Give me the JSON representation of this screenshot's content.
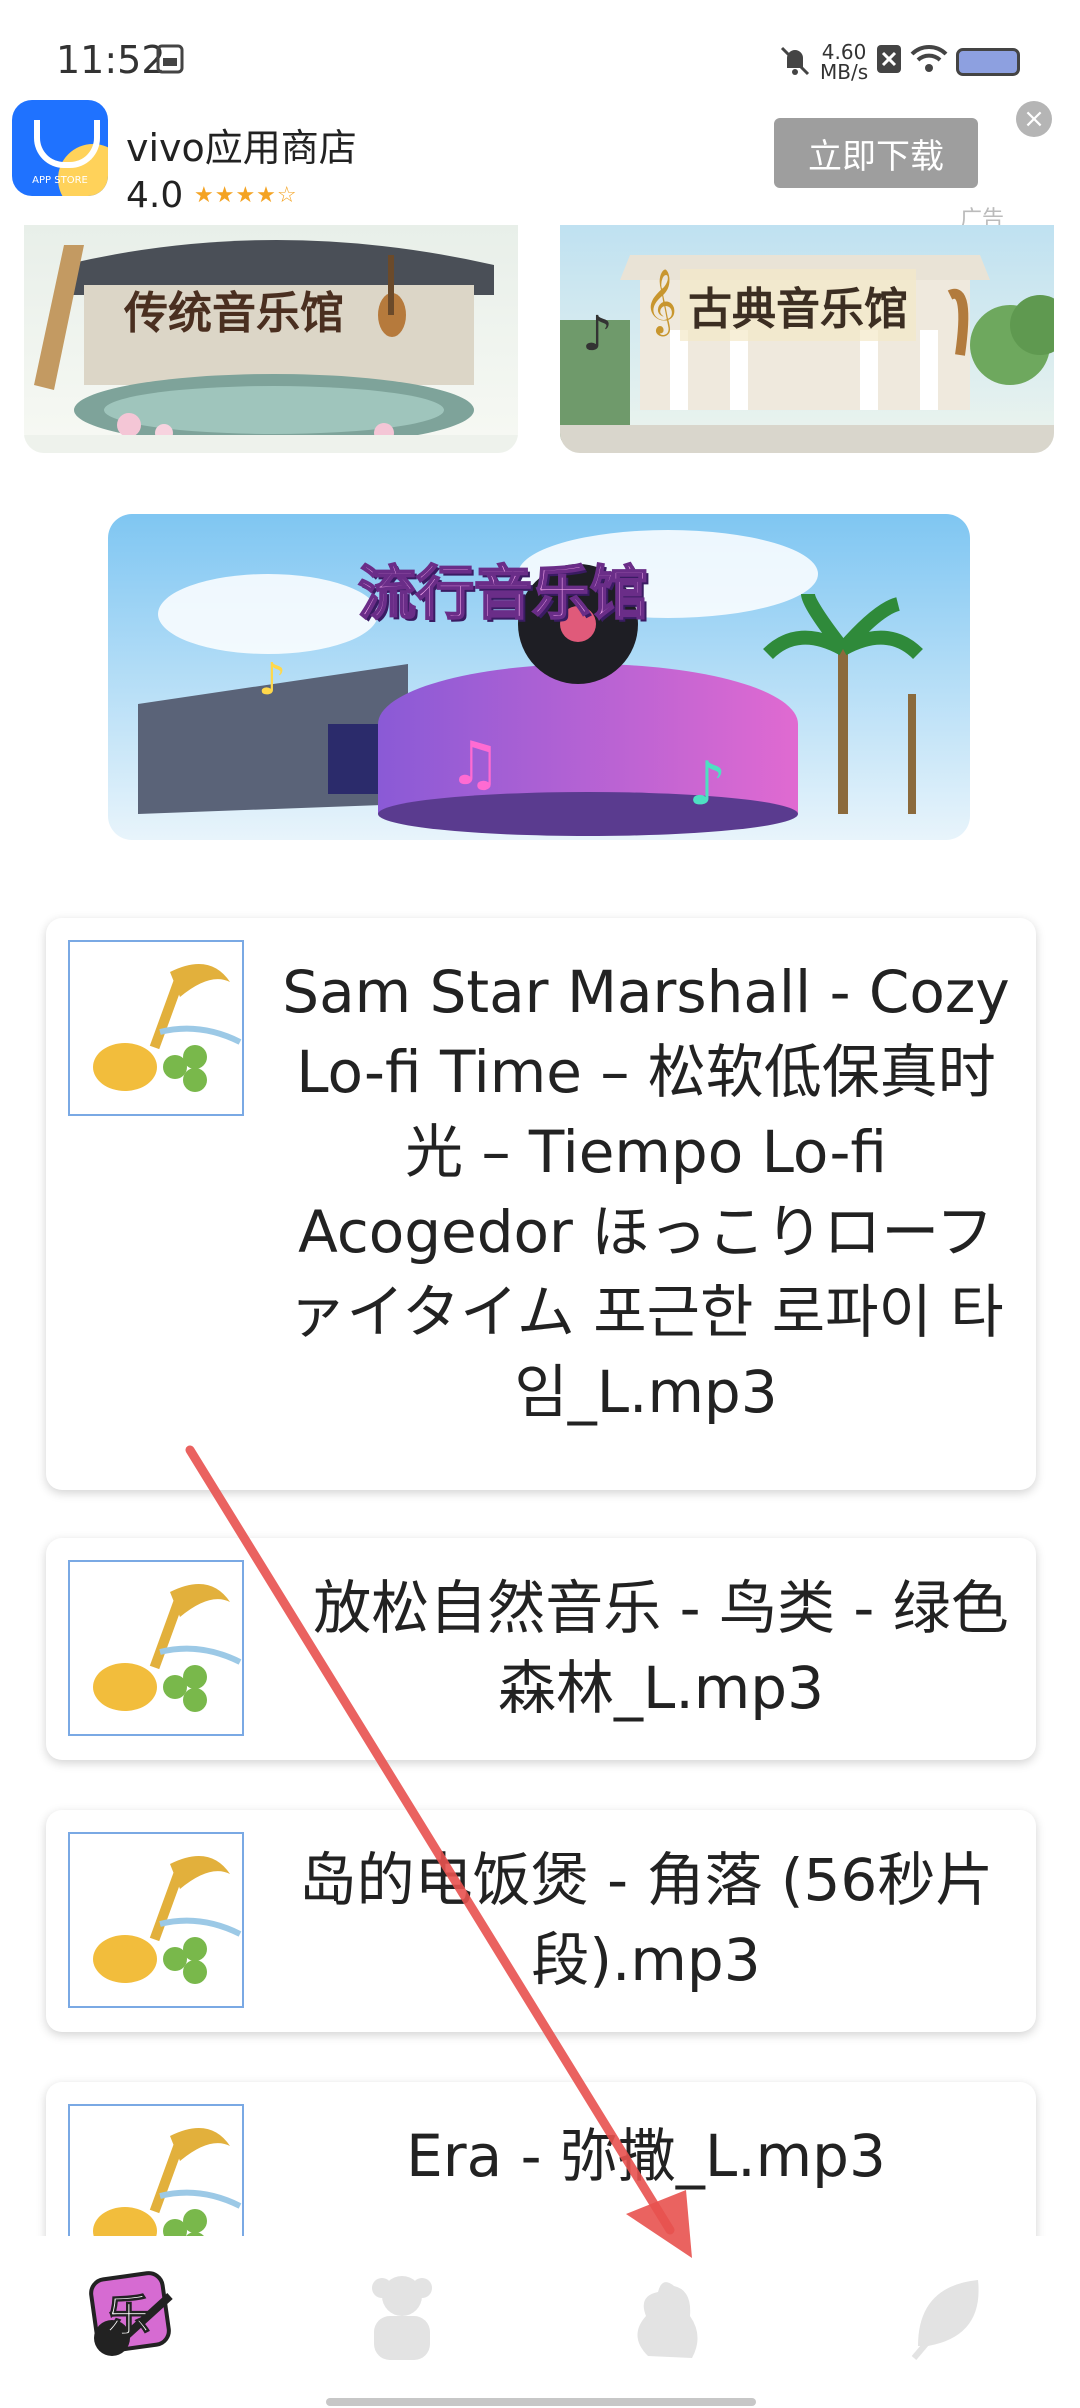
{
  "status_bar": {
    "time": "11:52",
    "net_speed_value": "4.60",
    "net_speed_unit": "MB/s"
  },
  "ad": {
    "app_name": "vivo应用商店",
    "rating": "4.0",
    "stars": "★★★★☆",
    "download_label": "立即下载",
    "close_label": "×",
    "ad_label": "广告",
    "logo_text": "APP STORE"
  },
  "halls": {
    "traditional": "传统音乐馆",
    "classical": "古典音乐馆",
    "pop": "流行音乐馆"
  },
  "songs": [
    {
      "title": "Sam Star Marshall - Cozy Lo-fi Time – 松软低保真时光 – Tiempo Lo-fi Acogedor ほっこりローファイタイム 포근한 로파이 타임_L.mp3"
    },
    {
      "title": "放松自然音乐 - 鸟类 - 绿色森林_L.mp3"
    },
    {
      "title": "岛的电饭煲 - 角落 (56秒片段).mp3"
    },
    {
      "title": "Era - 弥撒_L.mp3"
    }
  ],
  "bottom_nav": {
    "items": [
      {
        "icon": "music-hall-icon",
        "label": "乐"
      },
      {
        "icon": "person-icon"
      },
      {
        "icon": "squirrel-icon"
      },
      {
        "icon": "leaf-icon"
      }
    ]
  },
  "colors": {
    "accent_red": "#e8524f",
    "nav_active": "#d66bd2",
    "download_button": "#9e9e9e"
  }
}
